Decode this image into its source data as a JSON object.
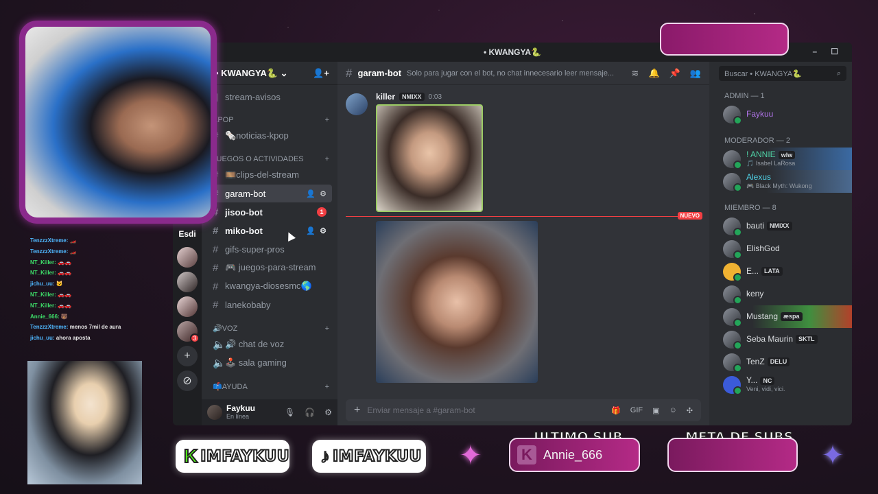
{
  "window": {
    "title": "• KWANGYA🐍",
    "minimize": "–",
    "maximize": "☐"
  },
  "rail": {
    "label": "Esdi",
    "badge": "3",
    "add": "+",
    "explore": "⊘"
  },
  "server": {
    "name": "• KWANGYA🐍",
    "chevron": "⌄",
    "invite": "👤+"
  },
  "channels": {
    "top": {
      "name": "stream-avisos"
    },
    "kpop_cat": "KPOP",
    "kpop": [
      {
        "name": "🗞️noticias-kpop"
      }
    ],
    "juegos_cat": "JUEGOS O ACTIVIDADES",
    "juegos": [
      {
        "name": "🎞️clips-del-stream"
      },
      {
        "name": "garam-bot"
      },
      {
        "name": "jisoo-bot",
        "badge": "1"
      },
      {
        "name": "miko-bot"
      },
      {
        "name": "gifs-super-pros"
      },
      {
        "name": "🎮 juegos-para-stream"
      },
      {
        "name": "kwangya-diosesmc🌎"
      },
      {
        "name": "lanekobaby"
      }
    ],
    "voz_cat": "🔊VOZ",
    "voz": [
      {
        "name": "🔊 chat de voz"
      },
      {
        "name": "🕹️ sala gaming"
      }
    ],
    "ayuda_cat": "📫AYUDA"
  },
  "userbar": {
    "name": "Faykuu",
    "status": "En línea"
  },
  "chat": {
    "channel": "garam-bot",
    "topic": "Solo para jugar con el bot, no chat innecesario leer mensaje...",
    "author": "killer",
    "author_tag": "NMIXX",
    "time": "0:03",
    "new_label": "NUEVO",
    "placeholder": "Enviar mensaje a #garam-bot",
    "gif": "GIF"
  },
  "members": {
    "search": "Buscar • KWANGYA🐍",
    "groups": [
      {
        "title": "ADMIN — 1",
        "items": [
          {
            "name": "Faykuu",
            "sub": ""
          }
        ]
      },
      {
        "title": "MODERADOR — 2",
        "items": [
          {
            "name": "! ANNIE",
            "tag": "wlw",
            "sub": "🎵 Isabel LaRosa"
          },
          {
            "name": "Alexus",
            "tag": "",
            "sub": "🎮 Black Myth: Wukong"
          }
        ]
      },
      {
        "title": "MIEMBRO — 8",
        "items": [
          {
            "name": "bauti",
            "tag": "NMIXX",
            "sub": ""
          },
          {
            "name": "ElishGod",
            "tag": "",
            "sub": ""
          },
          {
            "name": "E...",
            "tag": "LATA",
            "sub": ""
          },
          {
            "name": "keny",
            "tag": "",
            "sub": ""
          },
          {
            "name": "Mustang",
            "tag": "æspa",
            "sub": ""
          },
          {
            "name": "Seba Maurin",
            "tag": "SKTL",
            "sub": ""
          },
          {
            "name": "TenZ",
            "tag": "DELU",
            "sub": ""
          },
          {
            "name": "Y...",
            "tag": "NC",
            "sub": "Veni, vidi, vici."
          }
        ]
      }
    ]
  },
  "stream_chat": [
    {
      "user": "TenzzzXtreme:",
      "text": "🏎️",
      "color": "blue"
    },
    {
      "user": "TenzzzXtreme:",
      "text": "🏎️",
      "color": "blue"
    },
    {
      "user": "NT_Killer:",
      "text": "🚗🚗",
      "color": "green"
    },
    {
      "user": "NT_Killer:",
      "text": "🚗🚗",
      "color": "green"
    },
    {
      "user": "jichu_uu:",
      "text": "🐱",
      "color": "blue"
    },
    {
      "user": "NT_Killer:",
      "text": "🚗🚗",
      "color": "green"
    },
    {
      "user": "NT_Killer:",
      "text": "🚗🚗",
      "color": "green"
    },
    {
      "user": "Annie_666:",
      "text": "🐻",
      "color": "green"
    },
    {
      "user": "TenzzzXtreme:",
      "text": "menos 7mil de aura",
      "color": "blue"
    },
    {
      "user": "jichu_uu:",
      "text": "ahora aposta",
      "color": "blue"
    }
  ],
  "overlay": {
    "kick_logo": "K",
    "kick_handle": "IMFAYKUU",
    "tiktok_logo": "♪",
    "tiktok_handle": "IMFAYKUU",
    "last_sub_title": "ULTIMO SUB",
    "last_sub_name": "Annie_666",
    "meta_title": "META DE SUBS",
    "star": "✦"
  }
}
